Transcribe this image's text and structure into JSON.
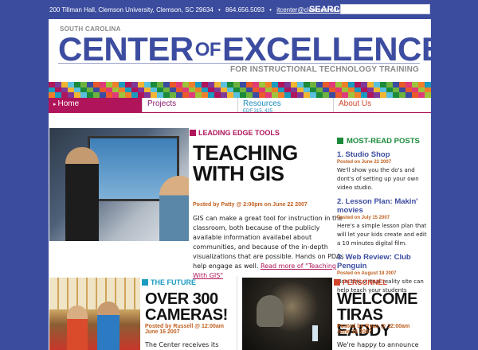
{
  "topbar": {
    "address": [
      "200 Tillman Hall, Clemson University, Clemson, SC 29634",
      "•",
      "864.656.5093",
      "•",
      "itcenter@clemson.edu"
    ],
    "search_label": "SEARCH:",
    "search_value": ""
  },
  "masthead": {
    "state": "SOUTH CAROLINA",
    "title_left": "CENTER",
    "title_of": "OF",
    "title_right": "EXCELLENCE",
    "subtitle": "FOR INSTRUCTIONAL TECHNOLOGY TRAINING"
  },
  "nav": {
    "home": "Home",
    "projects": "Projects",
    "resources": "Resources",
    "resources_sub": "EDF 315, 425",
    "about": "About Us"
  },
  "feature": {
    "category": "LEADING EDGE TOOLS",
    "headline_line1": "TEACHING",
    "headline_line2": "WITH GIS",
    "byline": "Posted by Patty @ 2:00pm on June 22 2007",
    "body": "GIS can make a great tool for instruction in the classroom, both because of the publicly available information availabel about communities, and because of the in-depth visualizations that are possible.  Hands on PDAs help engage as well.",
    "read_more": "Read more of \"Teaching With GIS\""
  },
  "sidebar": {
    "title": "MOST-READ POSTS",
    "entries": [
      {
        "title": "1. Studio Shop",
        "date": "Posted on June 22 2007",
        "text": "We'll show you the do's and dont's of setting up your own video studio."
      },
      {
        "title": "2. Lesson Plan: Makin' movies",
        "date": "Posted on July 15 2007",
        "text": "Here's a simple lesson plan that will let your kids create and edit a 10 minutes digital film."
      },
      {
        "title": "3. Web Review: Club Penguin",
        "date": "Posted on August 18 2007",
        "text": "How this virtual reality site can help teach your students"
      }
    ]
  },
  "story2": {
    "category": "THE FUTURE",
    "headline_line1": "OVER 300",
    "headline_line2": "CAMERAS!",
    "byline1": "Posted by Russell @ 12:00am",
    "byline2": "June 16 2007",
    "body": "The Center receives its first"
  },
  "story3": {
    "category": "PERSONNEL",
    "headline_line1": "WELCOME",
    "headline_line2": "TIRAS EADDY",
    "byline1": "Posted by Ryan @ 12:00am",
    "byline2": "June 16 2007",
    "body": "We're happy to announce that"
  },
  "colors": {
    "background": "#3b4b9e",
    "brand_blue": "#3c4ca0",
    "magenta": "#b0145a",
    "cyan": "#1a9bc0",
    "orange_red": "#d2452a",
    "green": "#1b8a3a"
  }
}
